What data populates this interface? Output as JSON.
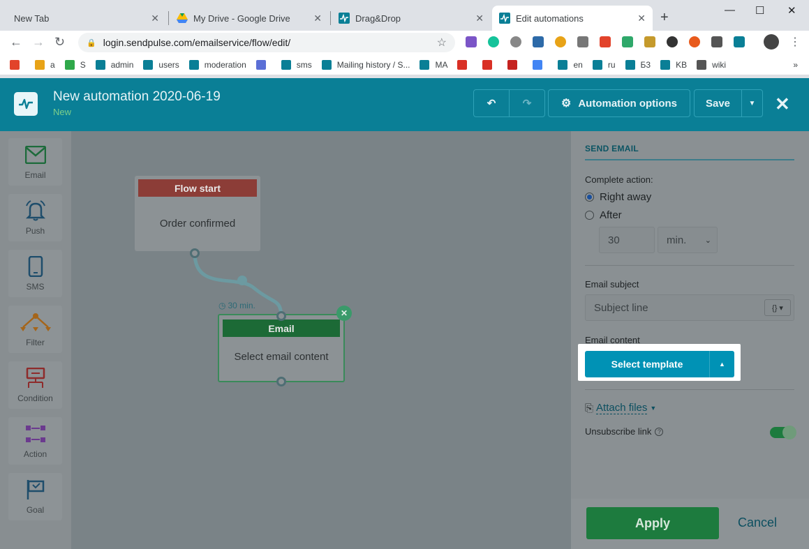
{
  "browser": {
    "tabs": [
      {
        "title": "New Tab"
      },
      {
        "title": "My Drive - Google Drive"
      },
      {
        "title": "Drag&Drop"
      },
      {
        "title": "Edit automations"
      }
    ],
    "close_glyph": "✕",
    "new_tab_glyph": "+",
    "window_controls": {
      "minimize": "—",
      "maximize": "☐",
      "close": "✕"
    },
    "url": "login.sendpulse.com/emailservice/flow/edit/",
    "bookmarks": [
      {
        "label": "",
        "icon": "joomla-icon"
      },
      {
        "label": "a",
        "icon": "k-icon"
      },
      {
        "label": "S",
        "icon": "chat-icon"
      },
      {
        "label": "admin",
        "icon": "sendpulse-icon"
      },
      {
        "label": "users",
        "icon": "sendpulse-icon"
      },
      {
        "label": "moderation",
        "icon": "sendpulse-icon"
      },
      {
        "label": "",
        "icon": "chart-icon"
      },
      {
        "label": "sms",
        "icon": "sendpulse-icon"
      },
      {
        "label": "Mailing history / S...",
        "icon": "sendpulse-icon"
      },
      {
        "label": "MA",
        "icon": "sendpulse-icon"
      },
      {
        "label": "",
        "icon": "mail-icon"
      },
      {
        "label": "",
        "icon": "gmail-icon"
      },
      {
        "label": "",
        "icon": "metrics-icon"
      },
      {
        "label": "",
        "icon": "translate-icon"
      },
      {
        "label": "en",
        "icon": "sendpulse-icon"
      },
      {
        "label": "ru",
        "icon": "sendpulse-icon"
      },
      {
        "label": "Б3",
        "icon": "sendpulse-icon"
      },
      {
        "label": "KB",
        "icon": "sendpulse-icon"
      },
      {
        "label": "wiki",
        "icon": "wiki-icon"
      }
    ],
    "bookmarks_more": "»"
  },
  "app": {
    "title": "New automation 2020-06-19",
    "status": "New",
    "automation_options_label": "Automation options",
    "save_label": "Save",
    "close_glyph": "✕",
    "accent": "#0a7f96"
  },
  "palette": [
    {
      "label": "Email",
      "icon": "email-icon"
    },
    {
      "label": "Push",
      "icon": "bell-icon"
    },
    {
      "label": "SMS",
      "icon": "phone-icon"
    },
    {
      "label": "Filter",
      "icon": "filter-icon"
    },
    {
      "label": "Condition",
      "icon": "condition-icon"
    },
    {
      "label": "Action",
      "icon": "action-icon"
    },
    {
      "label": "Goal",
      "icon": "flag-icon"
    }
  ],
  "canvas": {
    "flow_start": {
      "header": "Flow start",
      "body": "Order confirmed"
    },
    "delay_label": "30 min.",
    "email_node": {
      "header": "Email",
      "body": "Select email content"
    },
    "remove_glyph": "✕"
  },
  "panel": {
    "title": "SEND EMAIL",
    "complete_action_label": "Complete action:",
    "radio_right_away": "Right away",
    "radio_after": "After",
    "delay_value": "30",
    "delay_unit": "min.",
    "email_subject_label": "Email subject",
    "subject_placeholder": "Subject line",
    "email_content_label": "Email content",
    "select_template_label": "Select template",
    "attach_files_label": "Attach files",
    "unsubscribe_label": "Unsubscribe link",
    "unsubscribe_enabled": true,
    "apply_label": "Apply",
    "cancel_label": "Cancel"
  }
}
